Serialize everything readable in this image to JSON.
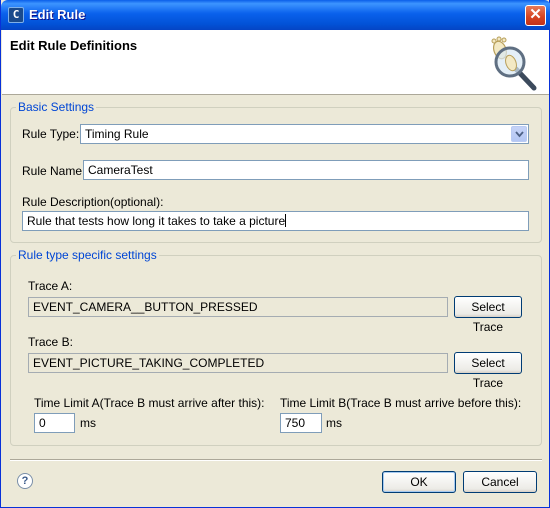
{
  "window": {
    "title": "Edit Rule",
    "app_icon_glyph": "C",
    "close_glyph": "✕"
  },
  "header": {
    "title": "Edit Rule Definitions",
    "logo_icon": "footprint-magnifier-icon"
  },
  "basic": {
    "legend": "Basic Settings",
    "rule_type_label": "Rule Type:",
    "rule_type_value": "Timing Rule",
    "rule_name_label": "Rule Name:",
    "rule_name_value": "CameraTest",
    "rule_desc_label": "Rule Description(optional):",
    "rule_desc_value": "Rule that tests how long it takes to take a picture"
  },
  "specific": {
    "legend": "Rule type specific settings",
    "trace_a_label": "Trace A:",
    "trace_a_value": "EVENT_CAMERA__BUTTON_PRESSED",
    "trace_b_label": "Trace B:",
    "trace_b_value": "EVENT_PICTURE_TAKING_COMPLETED",
    "select_trace_label": "Select Trace",
    "limit_a_label": "Time Limit A(Trace B must arrive after this):",
    "limit_a_value": "0",
    "limit_b_label": "Time Limit B(Trace B must arrive before this):",
    "limit_b_value": "750",
    "unit": "ms"
  },
  "footer": {
    "help_glyph": "?",
    "ok_label": "OK",
    "cancel_label": "Cancel"
  }
}
